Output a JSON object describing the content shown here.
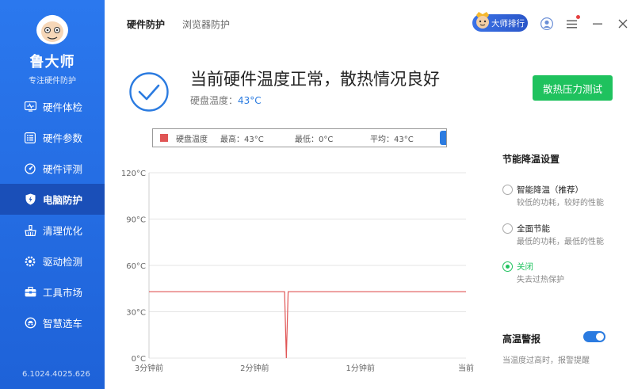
{
  "app": {
    "name": "鲁大师",
    "subtitle": "专注硬件防护",
    "version": "6.1024.4025.626"
  },
  "sidebar": {
    "items": [
      {
        "label": "硬件体检",
        "icon": "monitor-pulse-icon",
        "active": false
      },
      {
        "label": "硬件参数",
        "icon": "list-icon",
        "active": false
      },
      {
        "label": "硬件评测",
        "icon": "gauge-icon",
        "active": false
      },
      {
        "label": "电脑防护",
        "icon": "shield-icon",
        "active": true
      },
      {
        "label": "清理优化",
        "icon": "broom-icon",
        "active": false
      },
      {
        "label": "驱动检测",
        "icon": "gear-icon",
        "active": false
      },
      {
        "label": "工具市场",
        "icon": "toolbox-icon",
        "active": false
      },
      {
        "label": "智慧选车",
        "icon": "car-icon",
        "active": false
      }
    ]
  },
  "header": {
    "tabs": [
      {
        "label": "硬件防护",
        "active": true
      },
      {
        "label": "浏览器防护",
        "active": false
      }
    ],
    "rank_label": "大师排行"
  },
  "status": {
    "title": "当前硬件温度正常，散热情况良好",
    "temp_label": "硬盘温度：",
    "temp_value": "43°C",
    "stress_button": "散热压力测试"
  },
  "legend": {
    "name": "硬盘温度",
    "max": "最高：43°C",
    "min": "最低：0°C",
    "avg": "平均：43°C"
  },
  "chart_data": {
    "type": "line",
    "x": [
      0,
      40,
      77,
      78,
      79,
      80,
      180
    ],
    "y_labels": [
      "120°C",
      "90°C",
      "60°C",
      "30°C",
      "0°C"
    ],
    "x_labels": [
      "3分钟前",
      "2分钟前",
      "1分钟前",
      "当前"
    ],
    "series": [
      {
        "name": "硬盘温度",
        "values": [
          43,
          43,
          43,
          0,
          43,
          43,
          43
        ]
      }
    ],
    "ylim": [
      0,
      120
    ],
    "xlim": [
      0,
      180
    ],
    "grid": true,
    "line_color": "#e05555"
  },
  "panel": {
    "title": "节能降温设置",
    "options": [
      {
        "label": "智能降温（推荐）",
        "desc": "较低的功耗，较好的性能",
        "checked": false
      },
      {
        "label": "全面节能",
        "desc": "最低的功耗，最低的性能",
        "checked": false
      },
      {
        "label": "关闭",
        "desc": "失去过热保护",
        "checked": true
      }
    ],
    "alert_title": "高温警报",
    "alert_desc": "当温度过高时，报警提醒",
    "alert_on": true
  },
  "colors": {
    "sidebar": "#2b78ee",
    "sidebar_active": "#1a4fb8",
    "accent_green": "#1fc25e",
    "accent_blue": "#2b7be0",
    "line": "#e05555"
  }
}
